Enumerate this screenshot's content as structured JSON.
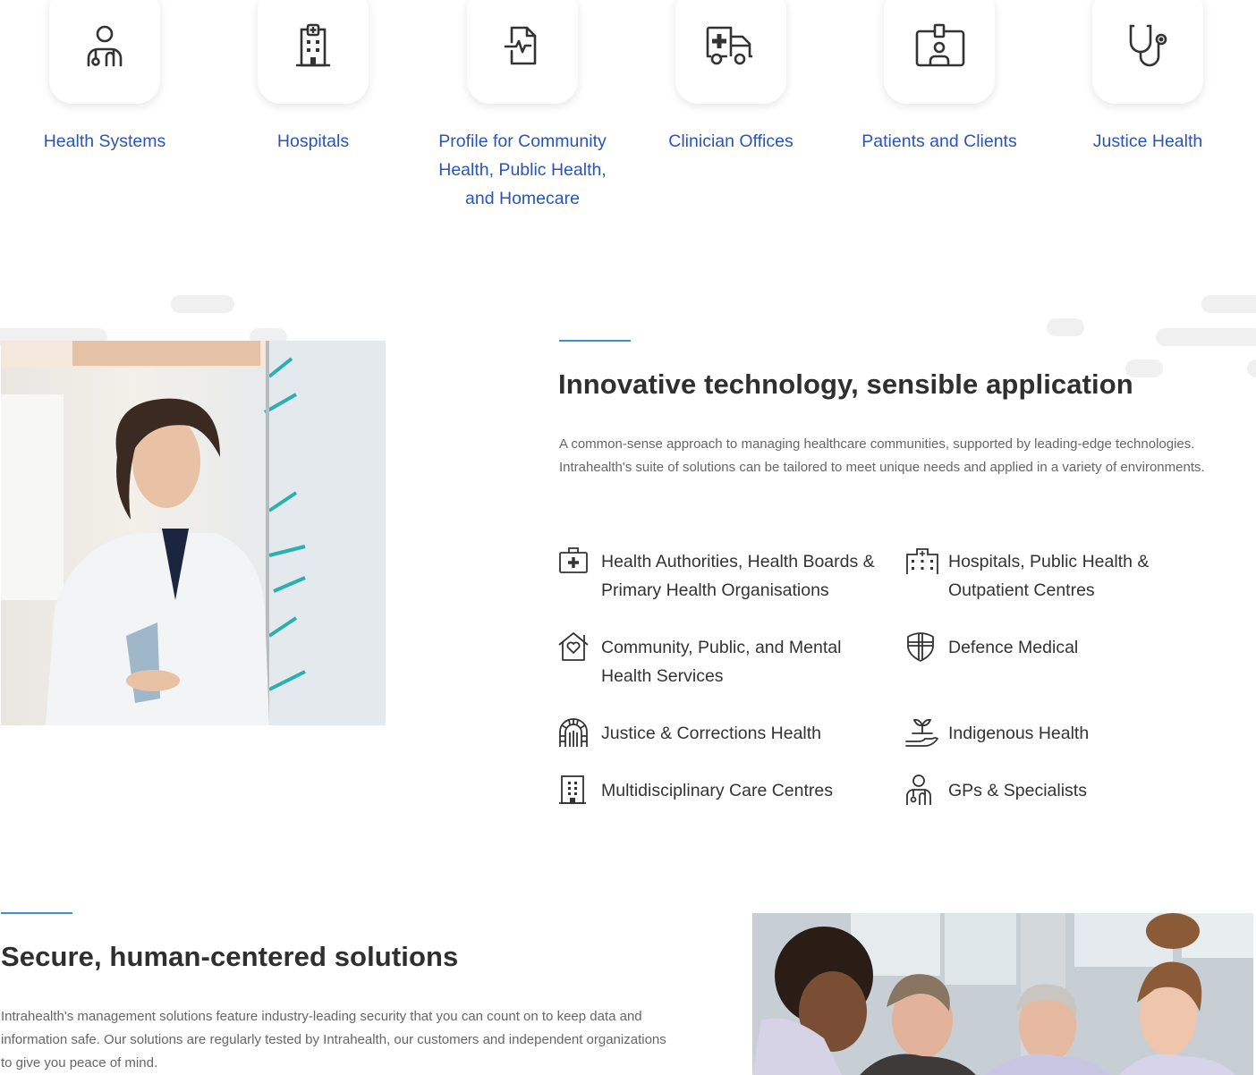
{
  "colors": {
    "link_blue": "#2a55b8",
    "accent": "#3a8ee6",
    "heading": "#2f2f2f",
    "body_text": "#666666",
    "icon": "#333333"
  },
  "categories": [
    {
      "label": "Health Systems",
      "icon": "doctor-icon"
    },
    {
      "label": "Hospitals",
      "icon": "hospital-building-icon"
    },
    {
      "label": "Profile for Community Health, Public Health, and Homecare",
      "icon": "medical-file-icon"
    },
    {
      "label": "Clinician Offices",
      "icon": "ambulance-icon"
    },
    {
      "label": "Patients and Clients",
      "icon": "id-badge-icon"
    },
    {
      "label": "Justice Health",
      "icon": "stethoscope-icon"
    }
  ],
  "innovative": {
    "title": "Innovative technology, sensible application",
    "body": "A common-sense approach to managing healthcare communities, supported by leading-edge technologies. Intrahealth's suite of solutions can be tailored to meet unique needs and applied in a variety of environments.",
    "image_alt": "Smiling doctor in lab coat holding a tablet",
    "features": [
      {
        "label": "Health Authorities, Health Boards & Primary Health Organisations",
        "icon": "first-aid-kit-icon"
      },
      {
        "label": "Hospitals, Public Health & Outpatient Centres",
        "icon": "hospital-icon"
      },
      {
        "label": "Community, Public, and Mental Health Services",
        "icon": "home-heart-icon"
      },
      {
        "label": "Defence Medical",
        "icon": "shield-cross-icon"
      },
      {
        "label": "Justice & Corrections Health",
        "icon": "prison-gate-icon"
      },
      {
        "label": "Indigenous Health",
        "icon": "plant-hand-icon"
      },
      {
        "label": "Multidisciplinary Care Centres",
        "icon": "building-icon"
      },
      {
        "label": "GPs & Specialists",
        "icon": "doctor-icon"
      }
    ]
  },
  "secure": {
    "title": "Secure, human-centered solutions",
    "body": "Intrahealth's management solutions feature industry-leading security that you can count on to keep data and information safe. Our solutions are regularly tested by Intrahealth, our customers and independent organizations to give you peace of mind.",
    "image_alt": "Healthcare team looking at a screen together"
  }
}
